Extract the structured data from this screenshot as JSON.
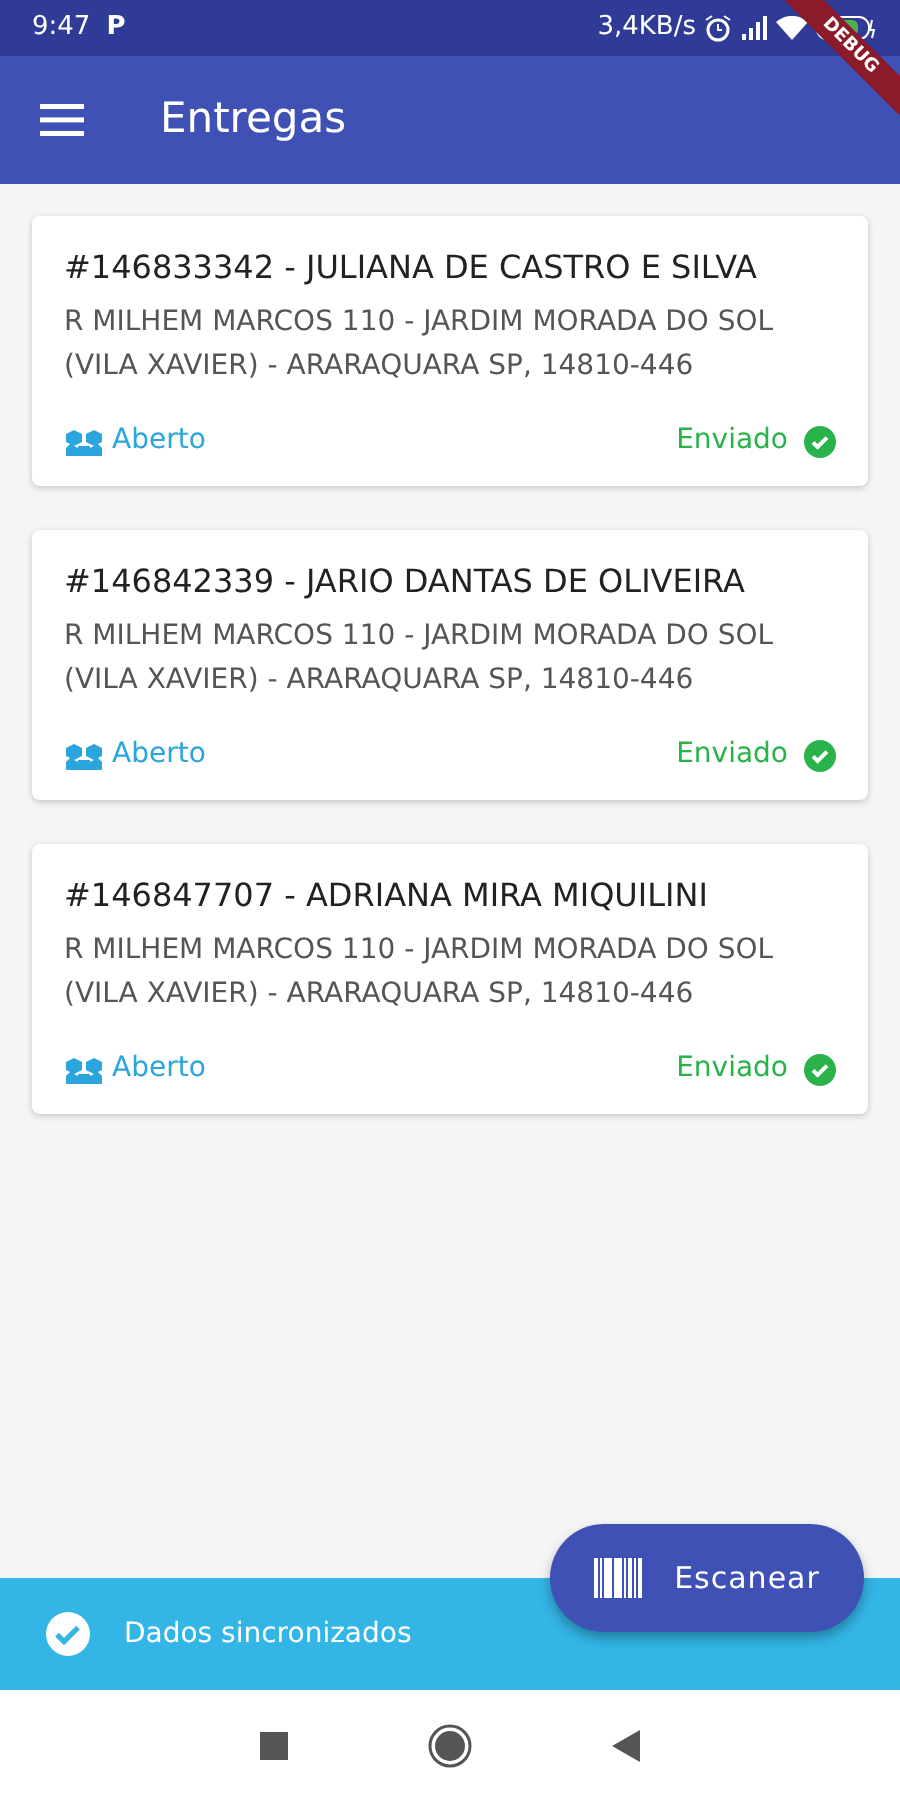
{
  "status_bar": {
    "time": "9:47",
    "app_letter": "P",
    "speed": "3,4KB/s"
  },
  "debug_banner": "DEBUG",
  "app_bar": {
    "title": "Entregas"
  },
  "deliveries": [
    {
      "title": "#146833342 - JULIANA DE CASTRO E SILVA",
      "address": "R MILHEM MARCOS 110 - JARDIM MORADA DO SOL (VILA XAVIER) - ARARAQUARA SP, 14810-446",
      "state": "Aberto",
      "sync": "Enviado"
    },
    {
      "title": "#146842339 - JARIO DANTAS DE OLIVEIRA",
      "address": "R MILHEM MARCOS 110 - JARDIM MORADA DO SOL (VILA XAVIER) - ARARAQUARA SP, 14810-446",
      "state": "Aberto",
      "sync": "Enviado"
    },
    {
      "title": "#146847707 - ADRIANA MIRA MIQUILINI",
      "address": "R MILHEM MARCOS 110 - JARDIM MORADA DO SOL (VILA XAVIER) - ARARAQUARA SP, 14810-446",
      "state": "Aberto",
      "sync": "Enviado"
    }
  ],
  "scan_button": "Escanear",
  "sync_bar": {
    "text": "Dados sincronizados",
    "synced": true
  }
}
